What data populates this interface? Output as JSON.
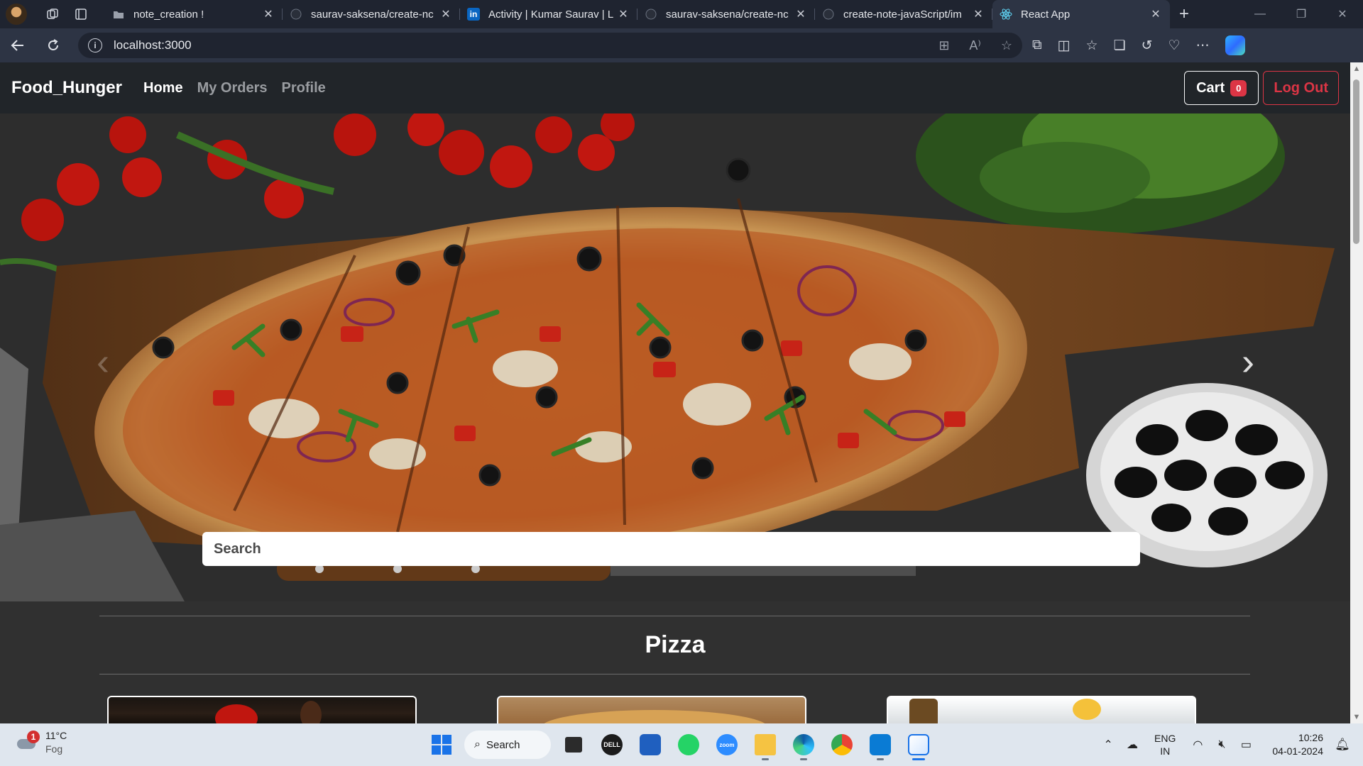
{
  "browser": {
    "tabs": [
      {
        "title": "note_creation !",
        "favicon": "page-icon",
        "active": false
      },
      {
        "title": "saurav-saksena/create-nc",
        "favicon": "github-icon",
        "active": false
      },
      {
        "title": "Activity | Kumar Saurav | L",
        "favicon": "linkedin-icon",
        "active": false
      },
      {
        "title": "saurav-saksena/create-nc",
        "favicon": "github-icon",
        "active": false
      },
      {
        "title": "create-note-javaScript/im",
        "favicon": "github-icon",
        "active": false
      },
      {
        "title": "React App",
        "favicon": "react-icon",
        "active": true
      }
    ],
    "url": "localhost:3000"
  },
  "app": {
    "brand": "Food_Hunger",
    "nav": {
      "home": "Home",
      "orders": "My Orders",
      "profile": "Profile"
    },
    "cart": {
      "label": "Cart",
      "count": "0"
    },
    "logout": "Log Out",
    "search_placeholder": "Search",
    "carousel": {
      "prev": "‹",
      "next": "›"
    },
    "category_title": "Pizza"
  },
  "taskbar": {
    "weather": {
      "temp": "11°C",
      "condition": "Fog",
      "alerts": "1"
    },
    "search_label": "Search",
    "lang": {
      "line1": "ENG",
      "line2": "IN"
    },
    "clock": {
      "time": "10:26",
      "date": "04-01-2024"
    }
  },
  "colors": {
    "navbar_bg": "#212529",
    "page_bg": "#303030",
    "danger": "#dc3545",
    "taskbar_bg": "#dfe6ee"
  }
}
